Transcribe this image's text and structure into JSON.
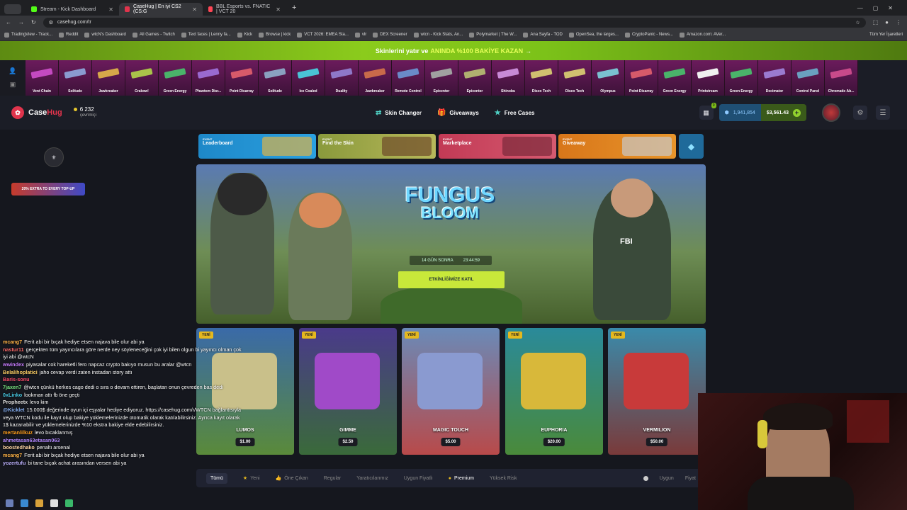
{
  "browser": {
    "tabs": [
      {
        "title": "Stream - Kick Dashboard",
        "color": "#53fc18"
      },
      {
        "title": "CaseHug | En iyi CS2 (CS:G",
        "color": "#e0344c"
      },
      {
        "title": "BBL Esports vs. FNATIC | VCT 20",
        "color": "#ff4655"
      }
    ],
    "new_tab": "+",
    "url": "casehug.com/tr",
    "bookmarks": [
      "TradingView - Track...",
      "Reddit",
      "wtcN's Dashboard",
      "All Games - Twitch",
      "Text faces | Lenny fa...",
      "Kick",
      "Browse | kick",
      "VCT 2026: EMEA Sta...",
      "vlr",
      "DEX Screener",
      "wtcn - Kick Stats, An...",
      "Polymarket | The W...",
      "Ana Sayfa - TOD",
      "OpenSea, the larges...",
      "CryptoPanic - News...",
      "Amazon.com: AVer..."
    ],
    "bookmarks_folder": "Tüm Yer İşaretleri"
  },
  "promo": {
    "before": "Skinlerini yatır ve",
    "highlight": "ANINDA %100 BAKİYE KAZAN",
    "arrow": "→"
  },
  "drops": [
    "Vent Chain",
    "Solitude",
    "Jawbreaker",
    "Crakow!",
    "Green Energy",
    "Phantom Disr...",
    "Point Disarray",
    "Solitude",
    "Ice Coaled",
    "Duality",
    "Jawbreaker",
    "Remote Control",
    "Epicenter",
    "Epicenter",
    "Shinobu",
    "Disco Tech",
    "Disco Tech",
    "Olympus",
    "Point Disarray",
    "Green Energy",
    "Printstream",
    "Green Energy",
    "Decimator",
    "Control Panel",
    "Chromatic Ab..."
  ],
  "drop_colors": [
    "#c44ac0",
    "#8a9bd0",
    "#d6a84a",
    "#a9c34a",
    "#4ab36a",
    "#9a6ad0",
    "#d65a6a",
    "#8aa0c0",
    "#4ac3d6",
    "#8e78c8",
    "#c86a4a",
    "#6a8ac8",
    "#a0a0a0",
    "#b0b070",
    "#c88ad6",
    "#d0c070",
    "#d0c070",
    "#7ac0d0",
    "#d65a6a",
    "#4ab36a",
    "#f0f0f0",
    "#4ab36a",
    "#9a7ad0",
    "#6aa0c0",
    "#c84a8a"
  ],
  "header": {
    "logo_a": "Case",
    "logo_b": "Hug",
    "online_count": "6 232",
    "online_label": "çevrimiçi",
    "nav": [
      {
        "label": "Skin Changer",
        "icon": "⇄"
      },
      {
        "label": "Giveaways",
        "icon": "🎁"
      },
      {
        "label": "Free Cases",
        "icon": "★"
      }
    ],
    "gift_badge": "0",
    "coins": "1,941,854",
    "balance": "$3,561.43"
  },
  "events": [
    {
      "tag": "EVENT",
      "title": "Leaderboard",
      "bg": "linear-gradient(90deg,#1e88c8,#2aa0e0)",
      "ill": "#d9b24a"
    },
    {
      "tag": "EVENT",
      "title": "Find the Skin",
      "bg": "linear-gradient(90deg,#8a9a3c,#b8b85a)",
      "ill": "#6d4a2a"
    },
    {
      "tag": "EVENT",
      "title": "Marketplace",
      "bg": "linear-gradient(90deg,#c23a55,#d65a70)",
      "ill": "#7a2a3a"
    },
    {
      "tag": "EVENT",
      "title": "Giveaway",
      "bg": "linear-gradient(90deg,#d8761a,#e8952a)",
      "ill": "#c8c8c8"
    }
  ],
  "hero": {
    "title_line1": "FUNGUS",
    "title_line2": "BLOOM",
    "days": "14 GÜN SONRA",
    "time": "23:44:59",
    "button": "ETKİNLİĞİMİZE KATIL",
    "badge": "FBI"
  },
  "cases": [
    {
      "tag": "YENİ",
      "name": "LUMOS",
      "price": "$1.00",
      "bg": "linear-gradient(180deg,#3a6aa8,#5a8a3a)",
      "item": "#c9c08a"
    },
    {
      "tag": "YENİ",
      "name": "GIMME",
      "price": "$2.50",
      "bg": "linear-gradient(180deg,#4a3a8a,#3a6a3a)",
      "item": "#a04ac8"
    },
    {
      "tag": "YENİ",
      "name": "MAGIC TOUCH",
      "price": "$5.00",
      "bg": "linear-gradient(180deg,#6a8ab8,#b84a4a)",
      "item": "#8a9ad0"
    },
    {
      "tag": "YENİ",
      "name": "EUPHORIA",
      "price": "$20.00",
      "bg": "linear-gradient(180deg,#2a8a9a,#4a8a3a)",
      "item": "#d8b83a"
    },
    {
      "tag": "YENİ",
      "name": "VERMILION",
      "price": "$50.00",
      "bg": "linear-gradient(180deg,#3a8aaa,#7a3a3a)",
      "item": "#c83a3a"
    }
  ],
  "filters": {
    "items": [
      {
        "label": "Tümü",
        "icon": ""
      },
      {
        "label": "Yeni",
        "icon": "★"
      },
      {
        "label": "Öne Çıkan",
        "icon": "👍"
      },
      {
        "label": "Regular",
        "icon": ""
      },
      {
        "label": "Yaratıcılarımız",
        "icon": ""
      },
      {
        "label": "Uygun Fiyatlı",
        "icon": ""
      },
      {
        "label": "Premium",
        "icon": "●"
      },
      {
        "label": "Yüksek Risk",
        "icon": ""
      }
    ],
    "right": [
      "Uygun",
      "Fiyat"
    ]
  },
  "overlay": {
    "banner": "20% EXTRA TO EVERY TOP-UP",
    "chat": [
      {
        "user": "mcang7",
        "color": "#ffb347",
        "msg": "Ferit abi bir bıçak hediye etsen najava bile olur abi ya"
      },
      {
        "user": "nastur11",
        "color": "#ff6b6b",
        "msg": "gerçekten tüm yayıncılara göre nerde ney söyleneceğini çok iyi bilen olgun bi yayıncı olman çok iyi abi @wtcN"
      },
      {
        "user": "wwindex",
        "color": "#c77dff",
        "msg": "piyasalar cok hareketli fero napcaz crypto bakıyo musun bu aralar @wtcn"
      },
      {
        "user": "Belalihoplatici",
        "color": "#ffd166",
        "msg": "jaho cevap verdi zaten instadan story attı"
      },
      {
        "user": "Baris-sonu",
        "color": "#ff4d6d",
        "msg": ""
      },
      {
        "user": "7jaxen7",
        "color": "#7ae582",
        "msg": "@wtcn çünkü herkes cago dedi o sıra o devam ettiren, başlatan onun çevreden bas dedi"
      },
      {
        "user": "0xLinko",
        "color": "#48cae4",
        "msg": "lookman attı fb öne geçti"
      },
      {
        "user": "Propheetx",
        "color": "#e0e0e0",
        "msg": "levo kim"
      },
      {
        "user": "@Kicklet",
        "color": "#8ab4f8",
        "msg": "15.000$ değerinde oyun içi eşyalar hediye ediyoruz. https://casehug.com/r/WTCN bağlantısıyla veya WTCN kodu ile kayıt olup bakiye yüklemelerinizde otomatik olarak katılabilirsiniz. Ayrıca kayıt olarak 1$ kazanabilir ve yüklemelerinizde %10 ekstra bakiye elde edebilirsiniz."
      },
      {
        "user": "mertanlilkuz",
        "color": "#ff9f1c",
        "msg": "levo bıcaklanmış"
      },
      {
        "user": "ahmetasan63etasan063",
        "color": "#b388ff",
        "msg": ""
      },
      {
        "user": "boostedhako",
        "color": "#ffd6a5",
        "msg": "penaltı arsenal"
      },
      {
        "user": "mcang7",
        "color": "#ffb347",
        "msg": "Ferit abi bir bıçak hediye etsen najava bile olur abi ya"
      },
      {
        "user": "yozertufu",
        "color": "#bdb2ff",
        "msg": "bi tane bıçak achat arasından versen abi ya"
      }
    ]
  }
}
